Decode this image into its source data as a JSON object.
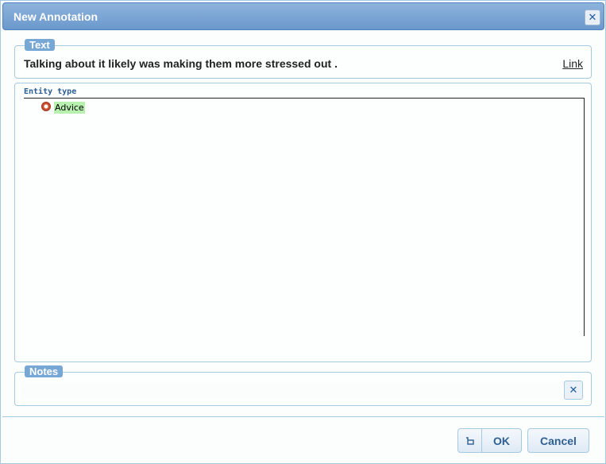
{
  "dialog": {
    "title": "New Annotation",
    "close_icon": "close-icon"
  },
  "text_section": {
    "legend": "Text",
    "selected_text": "Talking about it likely was making them more stressed out .",
    "link_label": "Link"
  },
  "type_section": {
    "label": "Entity type",
    "types": [
      {
        "name": "Advice",
        "selected": true,
        "color": "#b8f0b0"
      }
    ]
  },
  "notes_section": {
    "legend": "Notes",
    "value": "",
    "clear_icon": "clear-icon"
  },
  "buttons": {
    "ok_label": "OK",
    "cancel_label": "Cancel",
    "lock_icon": "lock-icon"
  },
  "colors": {
    "accent": "#77a7d4",
    "title_bar": "#6b98cc",
    "border": "#a6c9e2"
  }
}
